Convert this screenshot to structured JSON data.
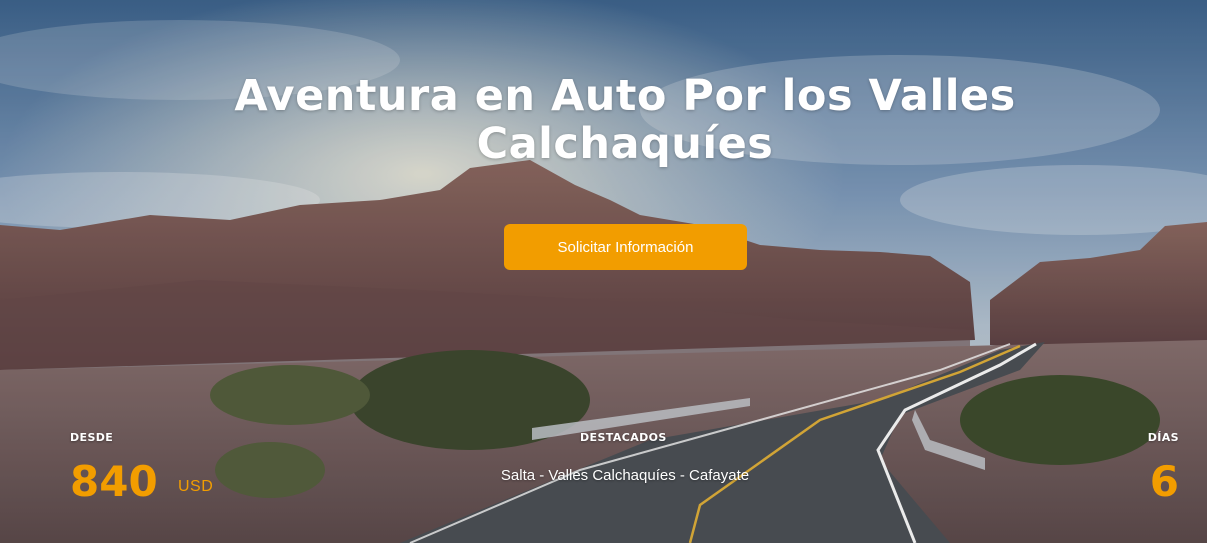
{
  "hero": {
    "title_line1": "Aventura en Auto Por los Valles",
    "title_line2": "Calchaquíes",
    "cta_label": "Solicitar Información"
  },
  "info": {
    "price": {
      "label": "DESDE",
      "amount": "840",
      "currency": "USD"
    },
    "highlights": {
      "label": "DESTACADOS",
      "text": "Salta - Valles Calchaquíes - Cafayate"
    },
    "days": {
      "label": "DÍAS",
      "value": "6"
    }
  },
  "colors": {
    "accent": "#f29d00",
    "text": "#ffffff"
  }
}
